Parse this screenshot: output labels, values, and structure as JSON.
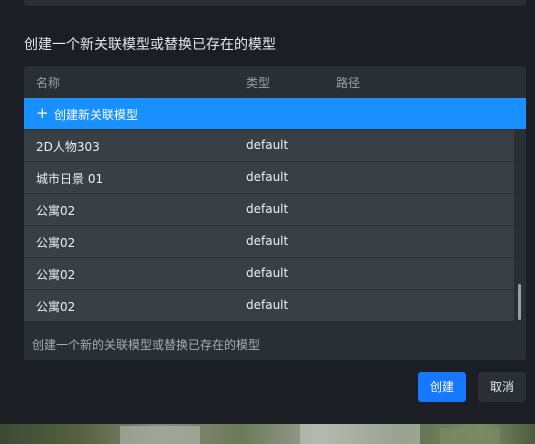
{
  "dialog": {
    "title": "创建一个新关联模型或替换已存在的模型",
    "hint": "创建一个新的关联模型或替换已存在的模型"
  },
  "table": {
    "columns": [
      "名称",
      "类型",
      "路径"
    ],
    "create_row_label": "创建新关联模型",
    "rows": [
      {
        "name": "2D人物303",
        "type": "default",
        "path": ""
      },
      {
        "name": "城市日景 01",
        "type": "default",
        "path": ""
      },
      {
        "name": "公寓02",
        "type": "default",
        "path": ""
      },
      {
        "name": "公寓02",
        "type": "default",
        "path": ""
      },
      {
        "name": "公寓02",
        "type": "default",
        "path": ""
      },
      {
        "name": "公寓02",
        "type": "default",
        "path": ""
      }
    ]
  },
  "buttons": {
    "create": "创建",
    "cancel": "取消"
  },
  "colors": {
    "accent": "#1890ff",
    "primary_button": "#1677ff",
    "row_bg": "#3a3f45",
    "panel_bg": "#2a2e35"
  }
}
